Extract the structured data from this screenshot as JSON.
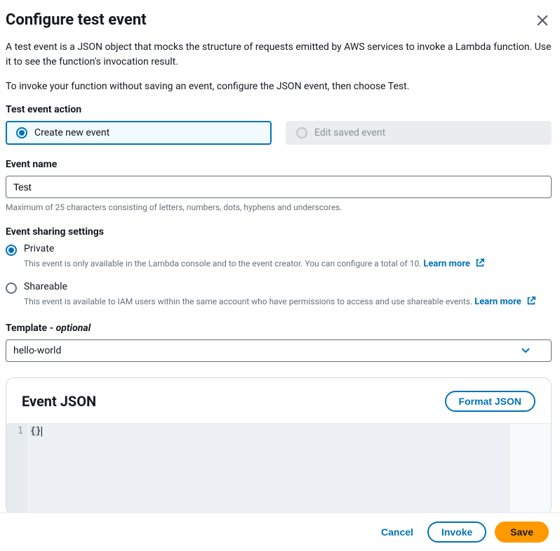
{
  "header": {
    "title": "Configure test event",
    "desc1": "A test event is a JSON object that mocks the structure of requests emitted by AWS services to invoke a Lambda function. Use it to see the function's invocation result.",
    "desc2": "To invoke your function without saving an event, configure the JSON event, then choose Test."
  },
  "action": {
    "label": "Test event action",
    "create": "Create new event",
    "edit": "Edit saved event"
  },
  "eventName": {
    "label": "Event name",
    "value": "Test",
    "hint": "Maximum of 25 characters consisting of letters, numbers, dots, hyphens and underscores."
  },
  "sharing": {
    "label": "Event sharing settings",
    "private": {
      "label": "Private",
      "desc": "This event is only available in the Lambda console and to the event creator. You can configure a total of 10."
    },
    "shareable": {
      "label": "Shareable",
      "desc": "This event is available to IAM users within the same account who have permissions to access and use shareable events."
    },
    "learnMore": "Learn more"
  },
  "template": {
    "label_prefix": "Template - ",
    "label_suffix": "optional",
    "value": "hello-world"
  },
  "json": {
    "title": "Event JSON",
    "format": "Format JSON",
    "lineNum": "1",
    "code": "{}"
  },
  "footer": {
    "cancel": "Cancel",
    "invoke": "Invoke",
    "save": "Save"
  }
}
